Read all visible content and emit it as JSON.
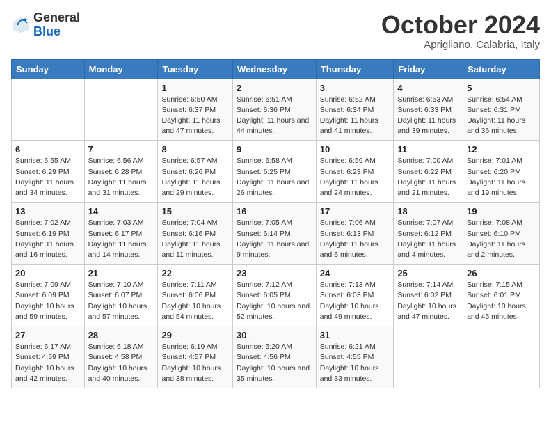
{
  "logo": {
    "general": "General",
    "blue": "Blue"
  },
  "title": "October 2024",
  "subtitle": "Aprigliano, Calabria, Italy",
  "headers": [
    "Sunday",
    "Monday",
    "Tuesday",
    "Wednesday",
    "Thursday",
    "Friday",
    "Saturday"
  ],
  "weeks": [
    [
      {
        "day": "",
        "info": ""
      },
      {
        "day": "",
        "info": ""
      },
      {
        "day": "1",
        "info": "Sunrise: 6:50 AM\nSunset: 6:37 PM\nDaylight: 11 hours and 47 minutes."
      },
      {
        "day": "2",
        "info": "Sunrise: 6:51 AM\nSunset: 6:36 PM\nDaylight: 11 hours and 44 minutes."
      },
      {
        "day": "3",
        "info": "Sunrise: 6:52 AM\nSunset: 6:34 PM\nDaylight: 11 hours and 41 minutes."
      },
      {
        "day": "4",
        "info": "Sunrise: 6:53 AM\nSunset: 6:33 PM\nDaylight: 11 hours and 39 minutes."
      },
      {
        "day": "5",
        "info": "Sunrise: 6:54 AM\nSunset: 6:31 PM\nDaylight: 11 hours and 36 minutes."
      }
    ],
    [
      {
        "day": "6",
        "info": "Sunrise: 6:55 AM\nSunset: 6:29 PM\nDaylight: 11 hours and 34 minutes."
      },
      {
        "day": "7",
        "info": "Sunrise: 6:56 AM\nSunset: 6:28 PM\nDaylight: 11 hours and 31 minutes."
      },
      {
        "day": "8",
        "info": "Sunrise: 6:57 AM\nSunset: 6:26 PM\nDaylight: 11 hours and 29 minutes."
      },
      {
        "day": "9",
        "info": "Sunrise: 6:58 AM\nSunset: 6:25 PM\nDaylight: 11 hours and 26 minutes."
      },
      {
        "day": "10",
        "info": "Sunrise: 6:59 AM\nSunset: 6:23 PM\nDaylight: 11 hours and 24 minutes."
      },
      {
        "day": "11",
        "info": "Sunrise: 7:00 AM\nSunset: 6:22 PM\nDaylight: 11 hours and 21 minutes."
      },
      {
        "day": "12",
        "info": "Sunrise: 7:01 AM\nSunset: 6:20 PM\nDaylight: 11 hours and 19 minutes."
      }
    ],
    [
      {
        "day": "13",
        "info": "Sunrise: 7:02 AM\nSunset: 6:19 PM\nDaylight: 11 hours and 16 minutes."
      },
      {
        "day": "14",
        "info": "Sunrise: 7:03 AM\nSunset: 6:17 PM\nDaylight: 11 hours and 14 minutes."
      },
      {
        "day": "15",
        "info": "Sunrise: 7:04 AM\nSunset: 6:16 PM\nDaylight: 11 hours and 11 minutes."
      },
      {
        "day": "16",
        "info": "Sunrise: 7:05 AM\nSunset: 6:14 PM\nDaylight: 11 hours and 9 minutes."
      },
      {
        "day": "17",
        "info": "Sunrise: 7:06 AM\nSunset: 6:13 PM\nDaylight: 11 hours and 6 minutes."
      },
      {
        "day": "18",
        "info": "Sunrise: 7:07 AM\nSunset: 6:12 PM\nDaylight: 11 hours and 4 minutes."
      },
      {
        "day": "19",
        "info": "Sunrise: 7:08 AM\nSunset: 6:10 PM\nDaylight: 11 hours and 2 minutes."
      }
    ],
    [
      {
        "day": "20",
        "info": "Sunrise: 7:09 AM\nSunset: 6:09 PM\nDaylight: 10 hours and 59 minutes."
      },
      {
        "day": "21",
        "info": "Sunrise: 7:10 AM\nSunset: 6:07 PM\nDaylight: 10 hours and 57 minutes."
      },
      {
        "day": "22",
        "info": "Sunrise: 7:11 AM\nSunset: 6:06 PM\nDaylight: 10 hours and 54 minutes."
      },
      {
        "day": "23",
        "info": "Sunrise: 7:12 AM\nSunset: 6:05 PM\nDaylight: 10 hours and 52 minutes."
      },
      {
        "day": "24",
        "info": "Sunrise: 7:13 AM\nSunset: 6:03 PM\nDaylight: 10 hours and 49 minutes."
      },
      {
        "day": "25",
        "info": "Sunrise: 7:14 AM\nSunset: 6:02 PM\nDaylight: 10 hours and 47 minutes."
      },
      {
        "day": "26",
        "info": "Sunrise: 7:15 AM\nSunset: 6:01 PM\nDaylight: 10 hours and 45 minutes."
      }
    ],
    [
      {
        "day": "27",
        "info": "Sunrise: 6:17 AM\nSunset: 4:59 PM\nDaylight: 10 hours and 42 minutes."
      },
      {
        "day": "28",
        "info": "Sunrise: 6:18 AM\nSunset: 4:58 PM\nDaylight: 10 hours and 40 minutes."
      },
      {
        "day": "29",
        "info": "Sunrise: 6:19 AM\nSunset: 4:57 PM\nDaylight: 10 hours and 38 minutes."
      },
      {
        "day": "30",
        "info": "Sunrise: 6:20 AM\nSunset: 4:56 PM\nDaylight: 10 hours and 35 minutes."
      },
      {
        "day": "31",
        "info": "Sunrise: 6:21 AM\nSunset: 4:55 PM\nDaylight: 10 hours and 33 minutes."
      },
      {
        "day": "",
        "info": ""
      },
      {
        "day": "",
        "info": ""
      }
    ]
  ]
}
